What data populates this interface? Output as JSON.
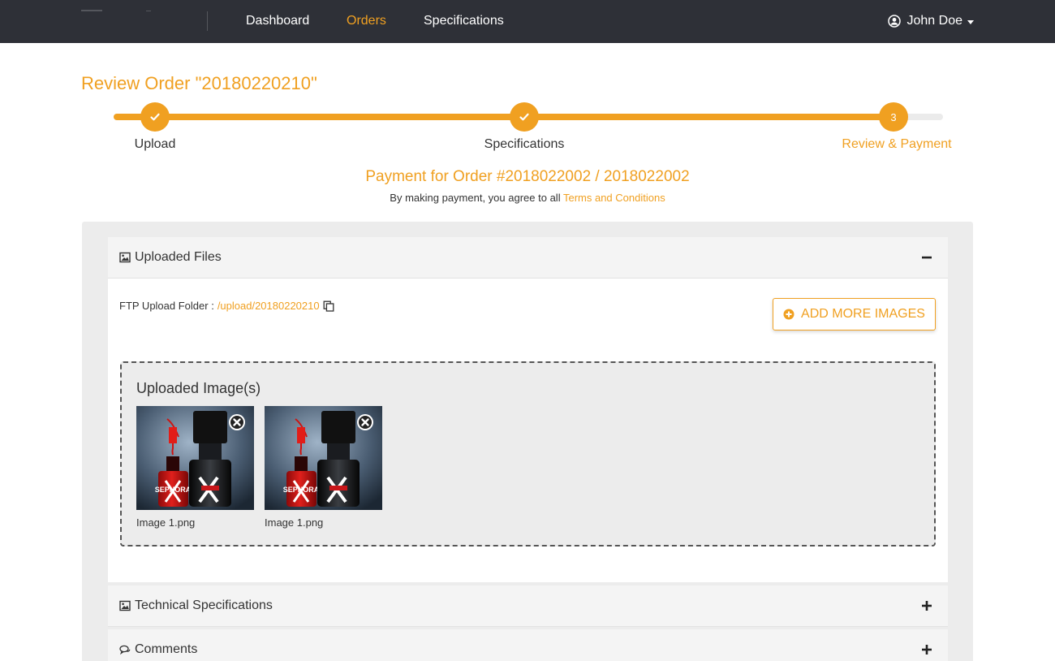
{
  "nav": {
    "links": [
      "Dashboard",
      "Orders",
      "Specifications"
    ],
    "active": "Orders",
    "user_name": "John Doe"
  },
  "page": {
    "title": "Review Order \"20180220210\""
  },
  "stepper": {
    "steps": [
      {
        "label": "Upload",
        "state": "done"
      },
      {
        "label": "Specifications",
        "state": "done"
      },
      {
        "label": "Review & Payment",
        "state": "current",
        "number": "3"
      }
    ]
  },
  "payment": {
    "title": "Payment for Order #2018022002 / 2018022002",
    "terms_prefix": "By making payment, you agree to all",
    "terms_link": "Terms and Conditions"
  },
  "uploaded_files": {
    "header": "Uploaded Files",
    "ftp_label": "FTP Upload Folder :",
    "ftp_path": "/upload/20180220210",
    "add_button": "ADD MORE IMAGES",
    "images_title": "Uploaded Image(s)",
    "images": [
      {
        "name": "Image 1.png"
      },
      {
        "name": "Image 1.png"
      }
    ]
  },
  "sections": {
    "technical": "Technical Specifications",
    "comments": "Comments"
  },
  "colors": {
    "accent": "#f0a021",
    "navbar": "#2e3037",
    "panel": "#ececec"
  },
  "icons": {
    "user": "user-circle-icon",
    "check": "check-icon",
    "image": "image-icon",
    "minus": "minus-icon",
    "plus": "plus-icon",
    "copy": "copy-icon",
    "add": "plus-circle-icon",
    "remove": "times-circle-icon",
    "comments": "comments-icon"
  }
}
